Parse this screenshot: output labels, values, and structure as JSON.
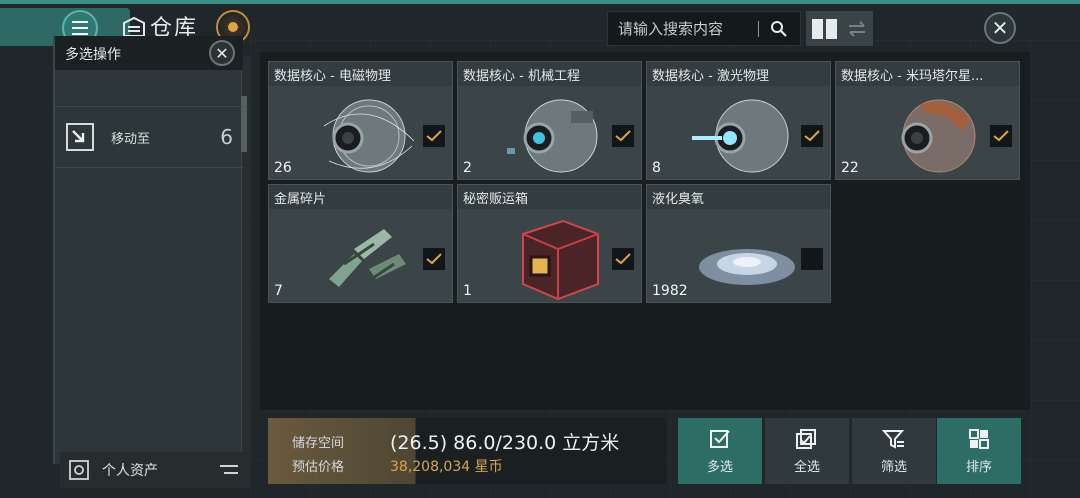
{
  "header": {
    "title": "仓库",
    "search_placeholder": "请输入搜索内容"
  },
  "left_panel": {
    "title": "多选操作",
    "move_label": "移动至",
    "move_count": "6",
    "bottom_label": "个人资产"
  },
  "items": [
    {
      "name": "数据核心 - 电磁物理",
      "qty": "26",
      "checked": true
    },
    {
      "name": "数据核心 - 机械工程",
      "qty": "2",
      "checked": true
    },
    {
      "name": "数据核心 - 激光物理",
      "qty": "8",
      "checked": true
    },
    {
      "name": "数据核心 - 米玛塔尔星...",
      "qty": "22",
      "checked": true
    },
    {
      "name": "金属碎片",
      "qty": "7",
      "checked": true
    },
    {
      "name": "秘密贩运箱",
      "qty": "1",
      "checked": true
    },
    {
      "name": "液化臭氧",
      "qty": "1982",
      "checked": false
    }
  ],
  "storage": {
    "space_label": "储存空间",
    "space_value": "(26.5) 86.0/230.0 立方米",
    "price_label": "预估价格",
    "price_value": "38,208,034 星币"
  },
  "actions": {
    "multi_select": "多选",
    "select_all": "全选",
    "filter": "筛选",
    "sort": "排序"
  },
  "colors": {
    "accent": "#2c6d66",
    "check": "#e0a24a",
    "gold_text": "#d9a548"
  }
}
